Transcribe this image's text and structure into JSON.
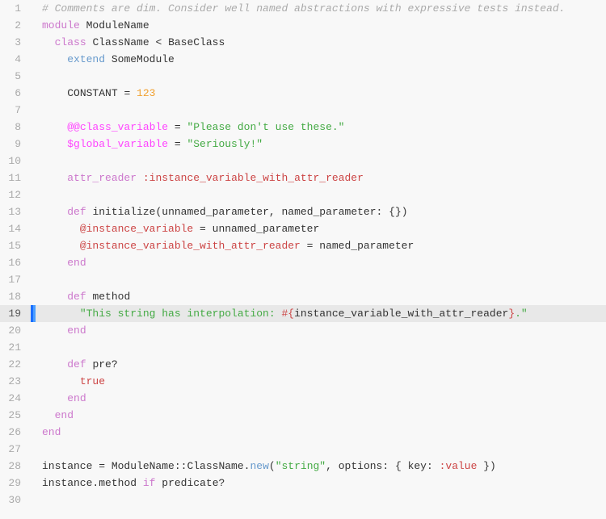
{
  "editor": {
    "lines": [
      {
        "num": 1,
        "highlighted": false
      },
      {
        "num": 2,
        "highlighted": false
      },
      {
        "num": 3,
        "highlighted": false
      },
      {
        "num": 4,
        "highlighted": false
      },
      {
        "num": 5,
        "highlighted": false
      },
      {
        "num": 6,
        "highlighted": false
      },
      {
        "num": 7,
        "highlighted": false
      },
      {
        "num": 8,
        "highlighted": false
      },
      {
        "num": 9,
        "highlighted": false
      },
      {
        "num": 10,
        "highlighted": false
      },
      {
        "num": 11,
        "highlighted": false
      },
      {
        "num": 12,
        "highlighted": false
      },
      {
        "num": 13,
        "highlighted": false
      },
      {
        "num": 14,
        "highlighted": false
      },
      {
        "num": 15,
        "highlighted": false
      },
      {
        "num": 16,
        "highlighted": false
      },
      {
        "num": 17,
        "highlighted": false
      },
      {
        "num": 18,
        "highlighted": false
      },
      {
        "num": 19,
        "highlighted": true
      },
      {
        "num": 20,
        "highlighted": false
      },
      {
        "num": 21,
        "highlighted": false
      },
      {
        "num": 22,
        "highlighted": false
      },
      {
        "num": 23,
        "highlighted": false
      },
      {
        "num": 24,
        "highlighted": false
      },
      {
        "num": 25,
        "highlighted": false
      },
      {
        "num": 26,
        "highlighted": false
      },
      {
        "num": 27,
        "highlighted": false
      },
      {
        "num": 28,
        "highlighted": false
      },
      {
        "num": 29,
        "highlighted": false
      },
      {
        "num": 30,
        "highlighted": false
      }
    ]
  }
}
